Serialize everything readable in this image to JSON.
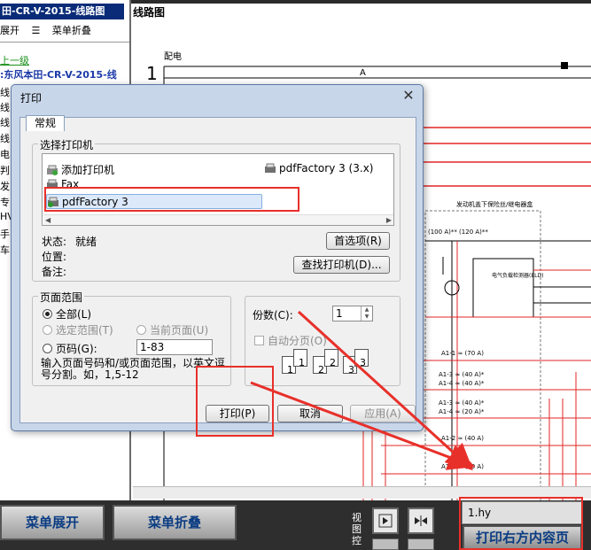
{
  "left_panel": {
    "title": "田-CR-V-2015-线路图",
    "expand": "展开",
    "collapse": "菜单折叠",
    "up_link": "上一级",
    "doc_link": "东风本田-CR-V-2015-线",
    "items": [
      "线",
      "线",
      "线",
      "线",
      "电",
      "判",
      "发",
      "专",
      "HV",
      "手",
      "车"
    ]
  },
  "header": {
    "title": "线路图"
  },
  "diagram": {
    "label_peidian": "配电",
    "page_num": "1",
    "column_a": "A",
    "box_title": "发动机盖下保险丝/继电器盒",
    "fuse_top": "(100 A)** (120 A)**",
    "eld_label": "电气负载检测器(ELD)",
    "fuses": [
      "A1-1 ≈ (70 A)",
      "A1-3 ≈ (40 A)*",
      "A1-4 ≈ (40 A)*",
      "A1-3 ≈ (40 A)*",
      "A1-4 ≈ (20 A)*",
      "A1-2 ≈ (40 A)",
      "A1-5 ≈ (30 A)"
    ]
  },
  "print_dialog": {
    "title": "打印",
    "tab_general": "常规",
    "group_printer": "选择打印机",
    "printers": [
      {
        "name": "添加打印机"
      },
      {
        "name": "pdfFactory 3 (3.x)"
      },
      {
        "name": "Fax"
      },
      {
        "name": "pdfFactory 3"
      }
    ],
    "selected_printer": "pdfFactory 3",
    "status_label": "状态:",
    "status_value": "就绪",
    "location_label": "位置:",
    "comment_label": "备注:",
    "preferences_button": "首选项(R)",
    "find_printer_button": "查找打印机(D)...",
    "group_range": "页面范围",
    "range_all": "全部(L)",
    "range_selection": "选定范围(T)",
    "range_current": "当前页面(U)",
    "range_pages": "页码(G):",
    "pages_value": "1-83",
    "pages_hint": "输入页面号码和/或页面范围，以英文逗号分割。如，1,5-12",
    "copies_label": "份数(C):",
    "copies_value": "1",
    "collate_label": "自动分页(O)",
    "collate_icons": [
      "1",
      "1",
      "2",
      "2",
      "3",
      "3"
    ],
    "print_button": "打印(P)",
    "cancel_button": "取消",
    "apply_button": "应用(A)"
  },
  "bottom_bar": {
    "expand_button": "菜单展开",
    "collapse_button": "菜单折叠",
    "view_label": "视图控",
    "hy_value": "1.hy",
    "print_right_button": "打印右方内容页"
  },
  "colors": {
    "highlight": "#e8302a",
    "wire_red": "#e32626",
    "bottom_bar": "#2e2e2e",
    "title_bar": "#0a2c78"
  }
}
